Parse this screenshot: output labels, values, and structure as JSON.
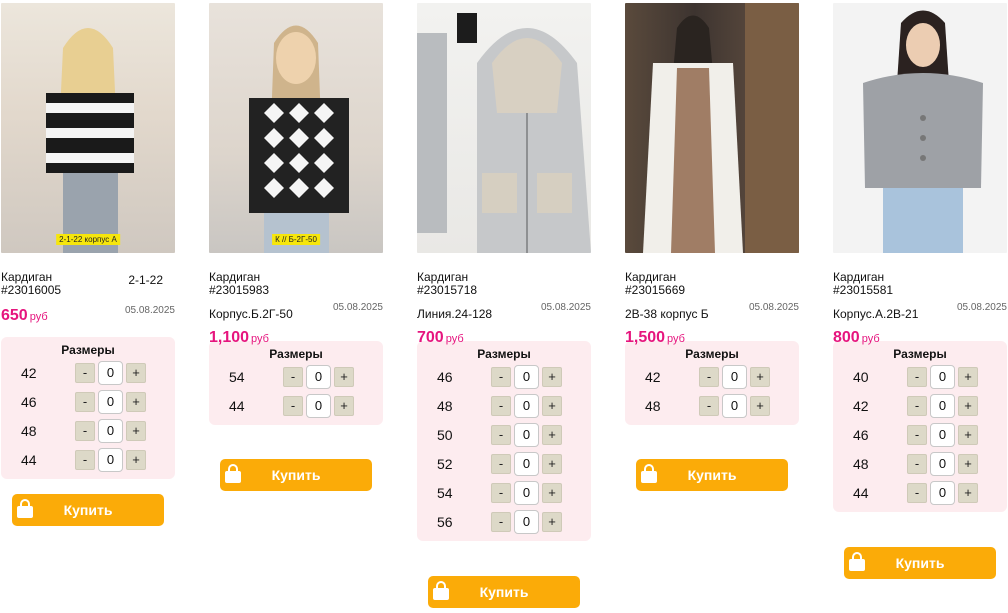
{
  "cards": [
    {
      "name": "Кардиган",
      "code": "#23016005",
      "location_right": "2-1-22",
      "date": "05.08.2025",
      "location": "",
      "price": "650",
      "currency": "руб",
      "tag": "2-1-22 корпус А",
      "sizes_title": "Размеры",
      "sizes": [
        "42",
        "46",
        "48",
        "44"
      ],
      "qty": [
        "0",
        "0",
        "0",
        "0"
      ],
      "buy_label": "Купить"
    },
    {
      "name": "Кардиган",
      "code": "#23015983",
      "location_right": "",
      "date": "05.08.2025",
      "location": "Корпус.Б.2Г-50",
      "price": "1,100",
      "currency": "руб",
      "tag": "К // Б-2Г-50",
      "sizes_title": "Размеры",
      "sizes": [
        "54",
        "44"
      ],
      "qty": [
        "0",
        "0"
      ],
      "buy_label": "Купить"
    },
    {
      "name": "Кардиган",
      "code": "#23015718",
      "location_right": "",
      "date": "05.08.2025",
      "location": "Линия.24-128",
      "price": "700",
      "currency": "руб",
      "tag": "",
      "sizes_title": "Размеры",
      "sizes": [
        "46",
        "48",
        "50",
        "52",
        "54",
        "56"
      ],
      "qty": [
        "0",
        "0",
        "0",
        "0",
        "0",
        "0"
      ],
      "buy_label": "Купить"
    },
    {
      "name": "Кардиган",
      "code": "#23015669",
      "location_right": "",
      "date": "05.08.2025",
      "location": "2В-38 корпус Б",
      "price": "1,500",
      "currency": "руб",
      "tag": "",
      "sizes_title": "Размеры",
      "sizes": [
        "42",
        "48"
      ],
      "qty": [
        "0",
        "0"
      ],
      "buy_label": "Купить"
    },
    {
      "name": "Кардиган",
      "code": "#23015581",
      "location_right": "",
      "date": "05.08.2025",
      "location": "Корпус.А.2В-21",
      "price": "800",
      "currency": "руб",
      "tag": "",
      "sizes_title": "Размеры",
      "sizes": [
        "40",
        "42",
        "46",
        "48",
        "44"
      ],
      "qty": [
        "0",
        "0",
        "0",
        "0",
        "0"
      ],
      "buy_label": "Купить"
    }
  ],
  "stepper": {
    "minus": "-",
    "plus": "+"
  },
  "colors": {
    "price": "#e6157e",
    "buy": "#fbab08",
    "sizes_bg": "#fdecef",
    "stepper": "#ddd9c8"
  },
  "icons": {
    "buy": "shopping-bag-icon"
  }
}
